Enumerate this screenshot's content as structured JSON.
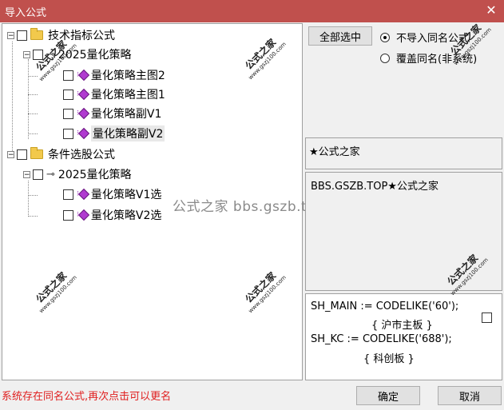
{
  "window": {
    "title": "导入公式",
    "close_icon": "close-icon"
  },
  "tree": {
    "groups": [
      {
        "label": "技术指标公式",
        "sub": {
          "label": "2025量化策略",
          "items": [
            "量化策略主图2",
            "量化策略主图1",
            "量化策略副V1",
            "量化策略副V2"
          ]
        }
      },
      {
        "label": "条件选股公式",
        "sub": {
          "label": "2025量化策略",
          "items": [
            "量化策略V1选",
            "量化策略V2选"
          ]
        }
      }
    ],
    "expander_symbol": "−"
  },
  "actions": {
    "select_all": "全部选中",
    "radio_skip": "不导入同名公式",
    "radio_overwrite": "覆盖同名(非系统)",
    "selected_radio": "skip"
  },
  "info": {
    "name_box": "★公式之家",
    "desc_box": "BBS.GSZB.TOP★公式之家",
    "code_lines": [
      "SH_MAIN := CODELIKE('60');",
      "{ 沪市主板 }",
      "SH_KC := CODELIKE('688');",
      "{ 科创板 }"
    ]
  },
  "watermarks": {
    "stamp_text": "公式之家",
    "stamp_url": "www.gszj100.com",
    "center_text": "公式之家 bbs.gszb.top"
  },
  "footer": {
    "status": "系统存在同名公式,再次点击可以更名",
    "ok": "确定",
    "cancel": "取消"
  }
}
